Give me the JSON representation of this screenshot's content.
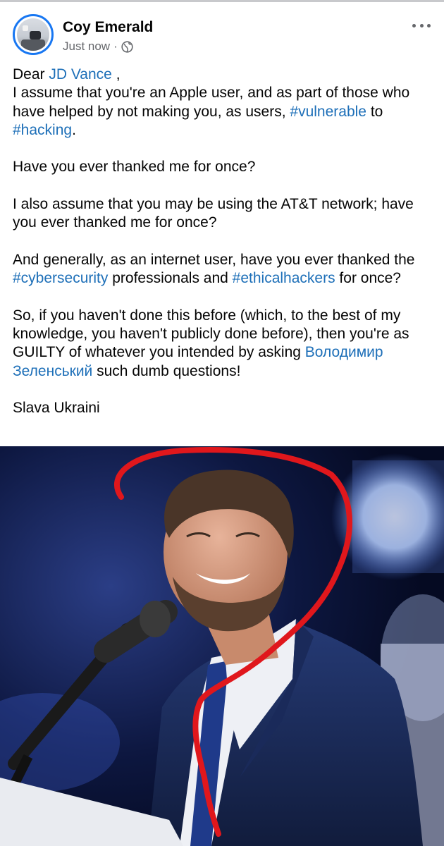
{
  "post": {
    "author": "Coy Emerald",
    "timestamp": "Just now",
    "meta_separator": "·",
    "privacy_icon": "globe-icon",
    "more_icon": "more-options-icon",
    "text": {
      "salutation_prefix": "Dear ",
      "salutation_link": "JD Vance",
      "salutation_suffix": " ,",
      "p1_a": "I assume that you're an Apple user, and as part of those who have helped by not making you, as users, ",
      "p1_tag1": "#vulnerable",
      "p1_b": " to ",
      "p1_tag2": "#hacking",
      "p1_c": ".",
      "p2": "Have you ever thanked me for once?",
      "p3": "I also assume that you may be using the AT&T network; have you ever thanked me for once?",
      "p4_a": "And generally, as an internet user, have you ever thanked the ",
      "p4_tag1": "#cybersecurity",
      "p4_b": " professionals and ",
      "p4_tag2": "#ethicalhackers",
      "p4_c": " for once?",
      "p5_a": "So, if you haven't done this before (which, to the best of my knowledge, you haven't publicly done before), then you're as GUILTY of whatever you intended by asking ",
      "p5_link": "Володимир Зеленський",
      "p5_b": " such dumb questions!",
      "p6": "Slava Ukraini",
      "flag_icon": "ukraine-flag-icon"
    },
    "photo": {
      "subject": "man smiling at microphone, red pen circle annotation"
    }
  },
  "colors": {
    "link": "#1d6fb8",
    "accent": "#1877f2",
    "secondary_text": "#65676b",
    "annotation": "#e0171c"
  }
}
